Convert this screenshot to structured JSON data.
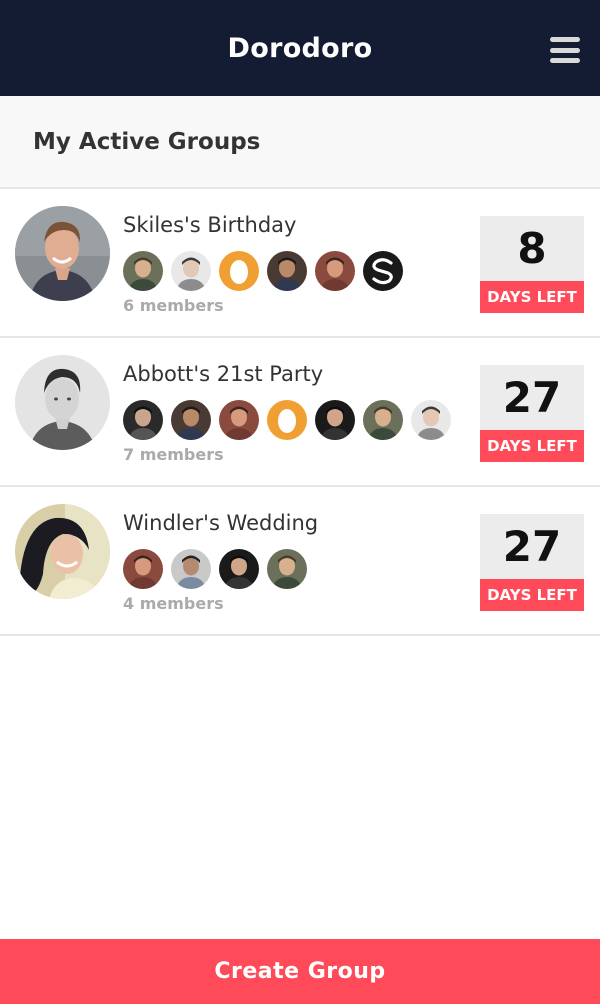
{
  "header": {
    "title": "Dorodoro",
    "menu_icon": "hamburger-menu-icon"
  },
  "section": {
    "title": "My Active Groups"
  },
  "groups": [
    {
      "name": "Skiles's Birthday",
      "owner_avatar": "man-smiling-portrait",
      "members": [
        "person-photo",
        "person-photo",
        "egg-avatar",
        "person-photo",
        "person-photo",
        "s-logo-avatar"
      ],
      "member_count": "6 members",
      "days": "8",
      "days_label": "DAYS LEFT"
    },
    {
      "name": "Abbott's 21st Party",
      "owner_avatar": "young-man-portrait",
      "members": [
        "person-photo",
        "person-photo",
        "person-photo",
        "egg-avatar",
        "person-photo",
        "person-photo",
        "person-photo"
      ],
      "member_count": "7 members",
      "days": "27",
      "days_label": "DAYS LEFT"
    },
    {
      "name": "Windler's Wedding",
      "owner_avatar": "woman-smiling-portrait",
      "members": [
        "person-photo",
        "person-photo",
        "person-photo",
        "person-photo"
      ],
      "member_count": "4 members",
      "days": "27",
      "days_label": "DAYS LEFT"
    }
  ],
  "footer": {
    "create_label": "Create Group"
  },
  "colors": {
    "header_bg": "#141c33",
    "accent": "#ff4a59",
    "egg_bg": "#f0a032",
    "muted_text": "#aaaaaa"
  }
}
